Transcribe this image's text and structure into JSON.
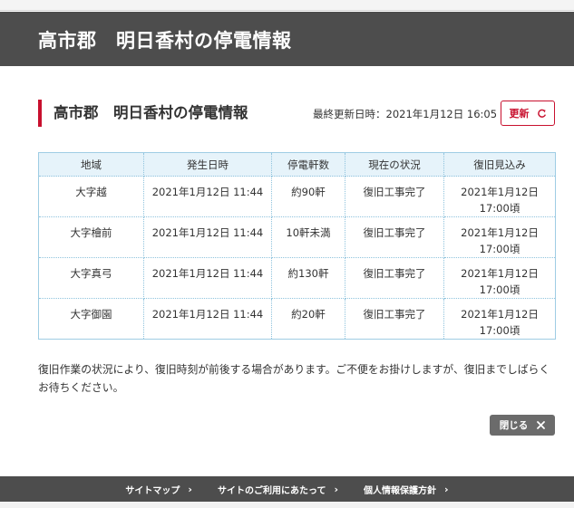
{
  "header": {
    "title": "高市郡　明日香村の停電情報"
  },
  "section": {
    "title": "高市郡　明日香村の停電情報",
    "updated_label": "最終更新日時：",
    "updated_value": "2021年1月12日 16:05",
    "refresh_label": "更新"
  },
  "table": {
    "headers": [
      "地域",
      "発生日時",
      "停電軒数",
      "現在の状況",
      "復旧見込み"
    ],
    "rows": [
      {
        "area": "大字越",
        "occurred": "2021年1月12日 11:44",
        "count": "約90軒",
        "status": "復旧工事完了",
        "eta_date": "2021年1月12日",
        "eta_time": "17:00頃"
      },
      {
        "area": "大字檜前",
        "occurred": "2021年1月12日 11:44",
        "count": "10軒未満",
        "status": "復旧工事完了",
        "eta_date": "2021年1月12日",
        "eta_time": "17:00頃"
      },
      {
        "area": "大字真弓",
        "occurred": "2021年1月12日 11:44",
        "count": "約130軒",
        "status": "復旧工事完了",
        "eta_date": "2021年1月12日",
        "eta_time": "17:00頃"
      },
      {
        "area": "大字御園",
        "occurred": "2021年1月12日 11:44",
        "count": "約20軒",
        "status": "復旧工事完了",
        "eta_date": "2021年1月12日",
        "eta_time": "17:00頃"
      }
    ]
  },
  "notice": "復旧作業の状況により、復旧時刻が前後する場合があります。ご不便をお掛けしますが、復旧までしばらくお待ちください。",
  "close_label": "閉じる",
  "footer": {
    "links": [
      {
        "label": "サイトマップ"
      },
      {
        "label": "サイトのご利用にあたって"
      },
      {
        "label": "個人情報保護方針"
      }
    ]
  },
  "colors": {
    "accent": "#c8102e",
    "header_bg": "#4d4d4d",
    "table_head_bg": "#e6f3fa",
    "table_border": "#8fc3dd"
  },
  "icons": {
    "refresh": "refresh-icon",
    "close": "close-icon",
    "footer_chevron": "chevron-right-icon"
  }
}
